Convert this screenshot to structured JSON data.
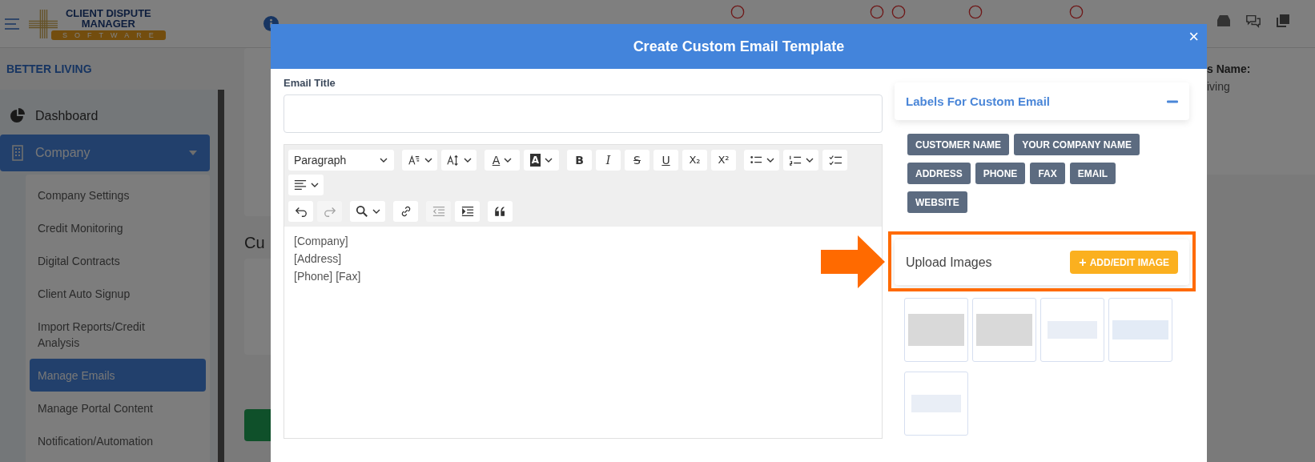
{
  "header": {
    "logo": {
      "lines": [
        "CLIENT DISPUTE",
        "MANAGER"
      ],
      "tagline": "SOFTWARE"
    }
  },
  "sidebar": {
    "account": "BETTER LIVING",
    "items": [
      {
        "label": "Dashboard",
        "selected": false
      },
      {
        "label": "Company",
        "selected": true,
        "expanded": true,
        "children": [
          {
            "label": "Company Settings",
            "selected": false
          },
          {
            "label": "Credit Monitoring",
            "selected": false
          },
          {
            "label": "Digital Contracts",
            "selected": false
          },
          {
            "label": "Client Auto Signup",
            "selected": false
          },
          {
            "label": "Import Reports/Credit Analysis",
            "selected": false
          },
          {
            "label": "Manage Emails",
            "selected": true
          },
          {
            "label": "Manage Portal Content",
            "selected": false
          },
          {
            "label": "Notification/Automation",
            "selected": false
          }
        ]
      }
    ]
  },
  "page": {
    "section_heading": "Cu",
    "side_label": "s Name:",
    "side_value": "iving"
  },
  "modal": {
    "title": "Create Custom Email Template",
    "close": "×",
    "email_title": {
      "label": "Email Title"
    },
    "editor": {
      "block_style": "Paragraph",
      "toolbar_rows": [
        [
          {
            "kind": "font_size",
            "disabled": false
          },
          {
            "kind": "font_family",
            "disabled": false
          },
          {
            "kind": "font_color",
            "glyph": "A",
            "disabled": false
          },
          {
            "kind": "highlight",
            "glyph": "A",
            "disabled": false
          },
          {
            "kind": "bold",
            "glyph": "B",
            "disabled": false
          },
          {
            "kind": "italic",
            "glyph": "I",
            "disabled": false
          },
          {
            "kind": "strike",
            "glyph": "S",
            "disabled": false
          },
          {
            "kind": "underline",
            "glyph": "U",
            "disabled": false
          },
          {
            "kind": "subscript",
            "glyph": "X₂",
            "disabled": false
          },
          {
            "kind": "superscript",
            "glyph": "X²",
            "disabled": false
          },
          {
            "kind": "bullets",
            "disabled": false
          },
          {
            "kind": "numbered",
            "disabled": false
          },
          {
            "kind": "todo",
            "disabled": false
          },
          {
            "kind": "align",
            "disabled": false
          }
        ],
        [
          {
            "kind": "undo",
            "disabled": false
          },
          {
            "kind": "redo",
            "disabled": true
          },
          {
            "kind": "find",
            "disabled": false
          },
          {
            "kind": "link",
            "disabled": false
          },
          {
            "kind": "outdent",
            "disabled": true
          },
          {
            "kind": "indent",
            "disabled": false
          },
          {
            "kind": "quote",
            "disabled": false
          }
        ]
      ],
      "content": [
        "[Company]",
        "[Address]",
        "[Phone] [Fax]"
      ]
    },
    "labels_card": {
      "title": "Labels For Custom Email",
      "expanded": true,
      "tags": [
        "CUSTOMER NAME",
        "YOUR COMPANY NAME",
        "ADDRESS",
        "PHONE",
        "FAX",
        "EMAIL",
        "WEBSITE"
      ]
    },
    "upload": {
      "title": "Upload Images",
      "button_icon": "+",
      "button": "ADD/EDIT IMAGE",
      "images": [
        {
          "kind": "banner"
        },
        {
          "kind": "banner"
        },
        {
          "kind": "logo"
        },
        {
          "kind": "screenshot"
        },
        {
          "kind": "logo"
        }
      ]
    }
  }
}
